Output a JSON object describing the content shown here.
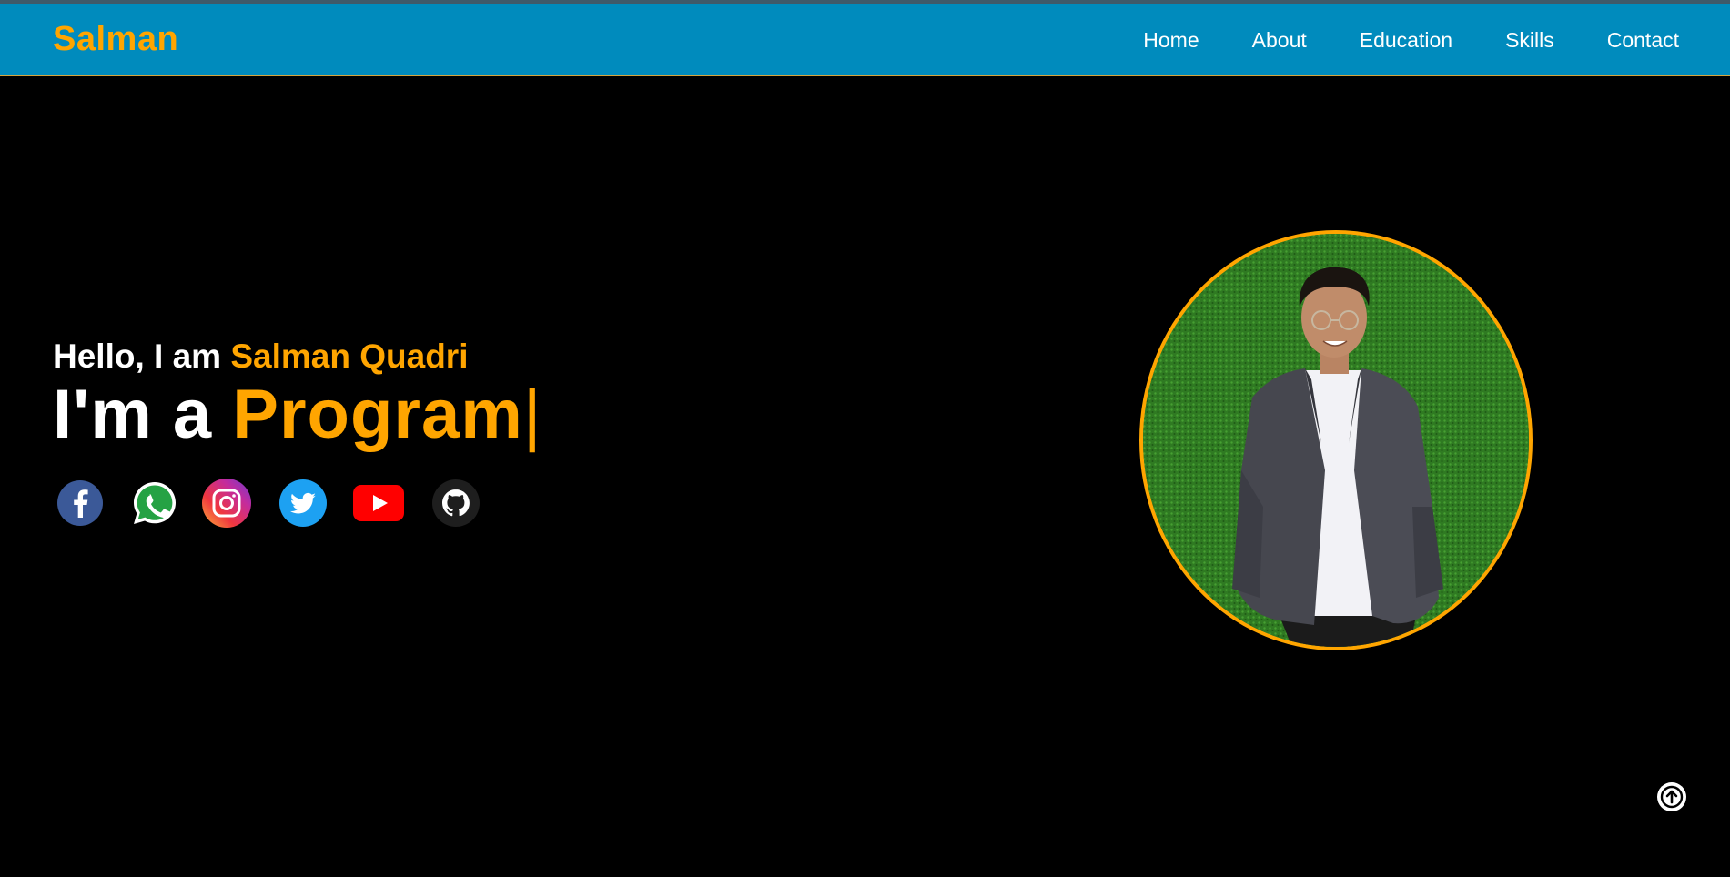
{
  "nav": {
    "logo": "Salman",
    "links": [
      {
        "label": "Home"
      },
      {
        "label": "About"
      },
      {
        "label": "Education"
      },
      {
        "label": "Skills"
      },
      {
        "label": "Contact"
      }
    ]
  },
  "hero": {
    "greeting": "Hello, I am ",
    "name": "Salman Quadri",
    "role_prefix": "I'm a ",
    "role_typed": "Program",
    "cursor": "|"
  },
  "socials": [
    {
      "icon": "facebook-icon"
    },
    {
      "icon": "whatsapp-icon"
    },
    {
      "icon": "instagram-icon"
    },
    {
      "icon": "twitter-icon"
    },
    {
      "icon": "youtube-icon"
    },
    {
      "icon": "github-icon"
    }
  ],
  "colors": {
    "accent": "#ffa500",
    "navbar": "#008bbd",
    "background": "#000000"
  }
}
